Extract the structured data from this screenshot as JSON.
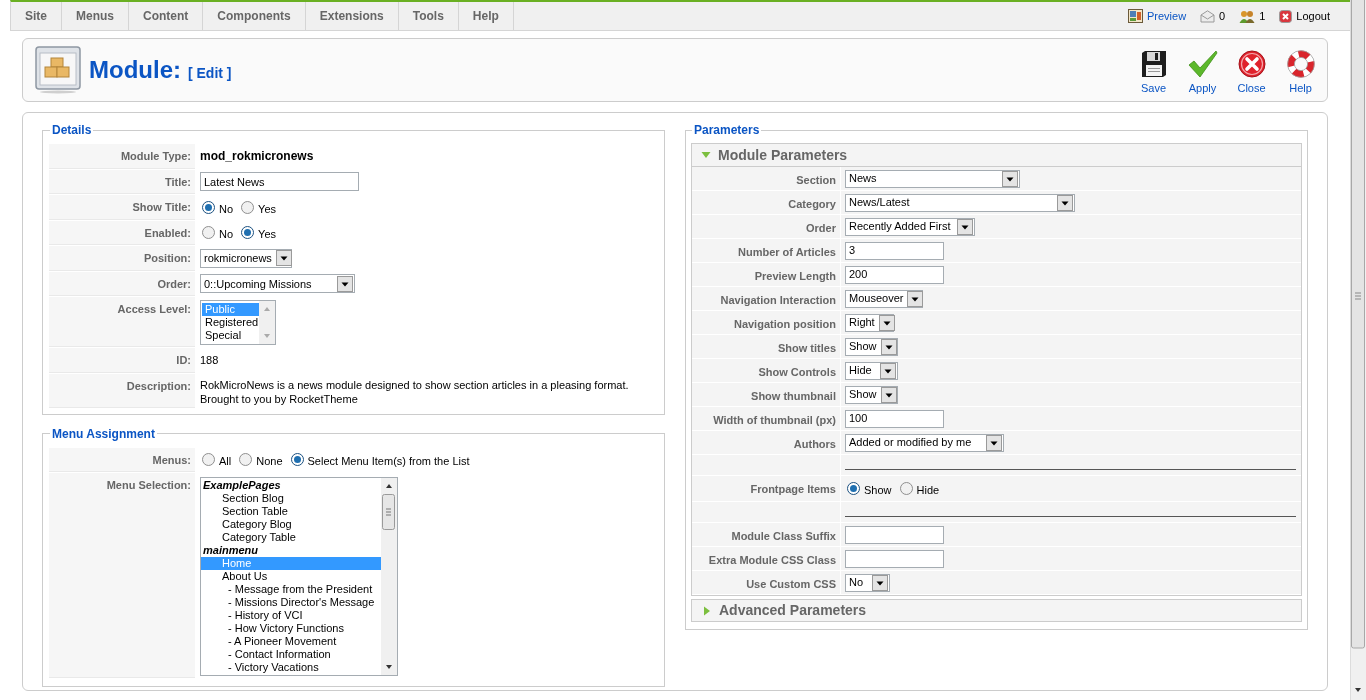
{
  "top_menu": {
    "items": [
      "Site",
      "Menus",
      "Content",
      "Components",
      "Extensions",
      "Tools",
      "Help"
    ],
    "status": [
      {
        "kind": "preview",
        "label": "Preview"
      },
      {
        "kind": "messages",
        "label": "0"
      },
      {
        "kind": "users",
        "label": "1"
      },
      {
        "kind": "logout",
        "label": "Logout"
      }
    ]
  },
  "header": {
    "title": "Module:",
    "subtitle": "[ Edit ]",
    "buttons": [
      {
        "kind": "save",
        "label": "Save"
      },
      {
        "kind": "apply",
        "label": "Apply"
      },
      {
        "kind": "close",
        "label": "Close"
      },
      {
        "kind": "help",
        "label": "Help"
      }
    ]
  },
  "details": {
    "legend": "Details",
    "rows": [
      {
        "kind": "strong_text",
        "label": "Module Type:",
        "value": "mod_rokmicronews"
      },
      {
        "kind": "input",
        "label": "Title:",
        "value": "Latest News"
      },
      {
        "kind": "radio",
        "label": "Show Title:",
        "options": [
          {
            "label": "No",
            "selected": true
          },
          {
            "label": "Yes",
            "selected": false
          }
        ]
      },
      {
        "kind": "radio",
        "label": "Enabled:",
        "options": [
          {
            "label": "No",
            "selected": false
          },
          {
            "label": "Yes",
            "selected": true
          }
        ]
      },
      {
        "kind": "select",
        "label": "Position:",
        "value": "rokmicronews"
      },
      {
        "kind": "select",
        "label": "Order:",
        "value": "0::Upcoming Missions"
      },
      {
        "kind": "listbox",
        "label": "Access Level:",
        "options": [
          {
            "label": "Public",
            "selected": true
          },
          {
            "label": "Registered",
            "selected": false
          },
          {
            "label": "Special",
            "selected": false
          }
        ]
      },
      {
        "kind": "text",
        "label": "ID:",
        "value": "188"
      },
      {
        "kind": "paragraph",
        "label": "Description:",
        "value": "RokMicroNews is a news module designed to show section articles in a pleasing format. Brought to you by RocketTheme"
      }
    ]
  },
  "menu_assignment": {
    "legend": "Menu Assignment",
    "rows": [
      {
        "kind": "radio",
        "label": "Menus:",
        "options": [
          {
            "label": "All",
            "selected": false
          },
          {
            "label": "None",
            "selected": false
          },
          {
            "label": "Select Menu Item(s) from the List",
            "selected": true
          }
        ]
      },
      {
        "kind": "tree_listbox",
        "label": "Menu Selection:",
        "items": [
          {
            "kind": "group",
            "label": "ExamplePages",
            "children": [
              {
                "kind": "item",
                "label": "Section Blog",
                "selected": false
              },
              {
                "kind": "item",
                "label": "Section Table",
                "selected": false
              },
              {
                "kind": "item",
                "label": "Category Blog",
                "selected": false
              },
              {
                "kind": "item",
                "label": "Category Table",
                "selected": false
              }
            ]
          },
          {
            "kind": "group",
            "label": "mainmenu",
            "children": [
              {
                "kind": "item",
                "label": "Home",
                "selected": true
              },
              {
                "kind": "item",
                "label": "About Us",
                "selected": false,
                "children": [
                  {
                    "kind": "item",
                    "label": "- Message from the President",
                    "selected": false
                  },
                  {
                    "kind": "item",
                    "label": "- Missions Director's Message",
                    "selected": false
                  },
                  {
                    "kind": "item",
                    "label": "- History of VCI",
                    "selected": false
                  },
                  {
                    "kind": "item",
                    "label": "- How Victory Functions",
                    "selected": false
                  },
                  {
                    "kind": "item",
                    "label": "- A Pioneer Movement",
                    "selected": false
                  },
                  {
                    "kind": "item",
                    "label": "- Contact Information",
                    "selected": false
                  },
                  {
                    "kind": "item",
                    "label": "- Victory Vacations",
                    "selected": false
                  }
                ]
              }
            ]
          }
        ]
      }
    ]
  },
  "parameters": {
    "legend": "Parameters",
    "panels": [
      {
        "title": "Module Parameters",
        "expanded": true,
        "rows": [
          {
            "kind": "select",
            "label": "Section",
            "value": "News"
          },
          {
            "kind": "select",
            "label": "Category",
            "value": "News/Latest"
          },
          {
            "kind": "select",
            "label": "Order",
            "value": "Recently Added First"
          },
          {
            "kind": "input",
            "label": "Number of Articles",
            "value": "3"
          },
          {
            "kind": "input",
            "label": "Preview Length",
            "value": "200"
          },
          {
            "kind": "select",
            "label": "Navigation Interaction",
            "value": "Mouseover"
          },
          {
            "kind": "select",
            "label": "Navigation position",
            "value": "Right"
          },
          {
            "kind": "select",
            "label": "Show titles",
            "value": "Show"
          },
          {
            "kind": "select",
            "label": "Show Controls",
            "value": "Hide"
          },
          {
            "kind": "select",
            "label": "Show thumbnail",
            "value": "Show"
          },
          {
            "kind": "input",
            "label": "Width of thumbnail (px)",
            "value": "100"
          },
          {
            "kind": "select",
            "label": "Authors",
            "value": "Added or modified by me"
          },
          {
            "kind": "separator"
          },
          {
            "kind": "radio",
            "label": "Frontpage Items",
            "options": [
              {
                "label": "Show",
                "selected": true
              },
              {
                "label": "Hide",
                "selected": false
              }
            ]
          },
          {
            "kind": "separator"
          },
          {
            "kind": "input",
            "label": "Module Class Suffix"
          },
          {
            "kind": "input",
            "label": "Extra Module CSS Class"
          },
          {
            "kind": "select",
            "label": "Use Custom CSS",
            "value": "No"
          }
        ]
      },
      {
        "title": "Advanced Parameters",
        "expanded": false
      }
    ]
  }
}
